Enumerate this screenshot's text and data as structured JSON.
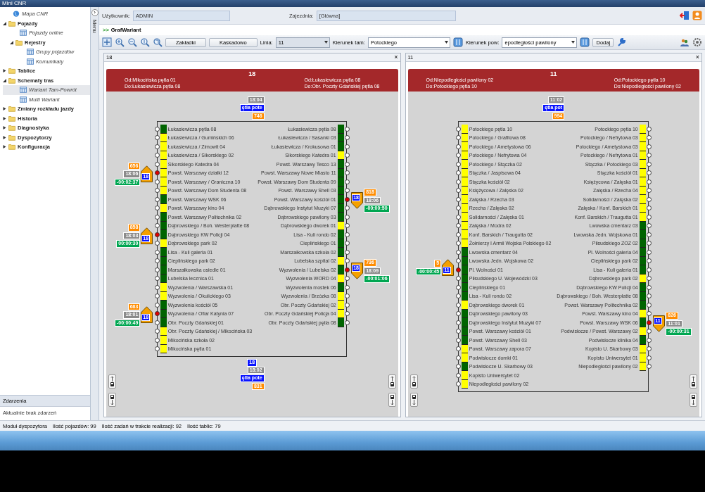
{
  "window": {
    "title": "Mini CNR"
  },
  "sidebar": {
    "items": [
      {
        "kind": "map",
        "label": "Mapa CNR",
        "selected": false
      },
      {
        "kind": "folder",
        "label": "Pojazdy",
        "expanded": true,
        "selected": false,
        "children": [
          {
            "kind": "view",
            "label": "Pojazdy online",
            "selected": false
          },
          {
            "kind": "folder",
            "label": "Rejestry",
            "expanded": true,
            "selected": false,
            "children": [
              {
                "kind": "view",
                "label": "Grupy pojazdów",
                "selected": false
              },
              {
                "kind": "view",
                "label": "Komunikaty",
                "selected": false
              }
            ]
          }
        ]
      },
      {
        "kind": "folder",
        "label": "Tablice",
        "expanded": false,
        "selected": false
      },
      {
        "kind": "folder",
        "label": "Schematy tras",
        "expanded": true,
        "selected": false,
        "children": [
          {
            "kind": "view",
            "label": "Wariant Tam-Powrót",
            "selected": true
          },
          {
            "kind": "view",
            "label": "Multi Wariant",
            "selected": false
          }
        ]
      },
      {
        "kind": "folder",
        "label": "Zmiany rozkładu jazdy",
        "expanded": false,
        "selected": false
      },
      {
        "kind": "folder",
        "label": "Historia",
        "expanded": false,
        "selected": false
      },
      {
        "kind": "folder",
        "label": "Diagnostyka",
        "expanded": false,
        "selected": false
      },
      {
        "kind": "folder",
        "label": "Dyspozytorzy",
        "expanded": false,
        "selected": false
      },
      {
        "kind": "folder",
        "label": "Konfiguracja",
        "expanded": false,
        "selected": false
      }
    ]
  },
  "events": {
    "title": "Zdarzenia",
    "message": "Aktualnie brak zdarzeń"
  },
  "menu_strip": {
    "label": "Menu",
    "toggle": "›"
  },
  "user_bar": {
    "user_label": "Użytkownik:",
    "user": "ADMIN",
    "depot_label": "Zajezdnia:",
    "depot": "[Główna]"
  },
  "breadcrumb": {
    "prefix": ">>",
    "title": "GrafWariant"
  },
  "toolbar": {
    "buttons": [
      "Zakładki",
      "Kaskadowo"
    ],
    "line_label": "Linia:",
    "line": "11",
    "dir_to_label": "Kierunek tam:",
    "dir_to": "Potockiego",
    "dir_back_label": "Kierunek pow:",
    "dir_back": "epodległości pawilony",
    "add": "Dodaj"
  },
  "panels": [
    {
      "tab": "18",
      "close": "×",
      "diagram": {
        "line": "18",
        "left_from": "Od:Mikocińska pętla 01",
        "left_to": "Do:Łukasiewicza pętla 08",
        "right_from": "Od:Łukasiewicza pętla 08",
        "right_to": "Do:Obr. Poczty Gdańskiej pętla 08",
        "top_vehicle": {
          "labels": [
            {
              "kind": "time",
              "text": "18:04"
            },
            {
              "kind": "route",
              "text": "ętla pote"
            },
            {
              "kind": "fleet",
              "text": "746"
            }
          ]
        },
        "bottom_vehicle": {
          "line": "18",
          "labels": [
            {
              "kind": "time",
              "text": "18:02"
            },
            {
              "kind": "route",
              "text": "ętla pote"
            },
            {
              "kind": "fleet",
              "text": "831"
            }
          ]
        },
        "left_stops": [
          {
            "name": "Łukasiewicza pętla 08",
            "color": "#006400"
          },
          {
            "name": "Łukasiewicza / Gumińskich 06",
            "color": "#ffff00"
          },
          {
            "name": "Łukasiewicza / Zimowit 04",
            "color": "#ffff00"
          },
          {
            "name": "Łukasiewicza / Sikorskiego 02",
            "color": "#ffff00"
          },
          {
            "name": "Sikorskiego Katedra 04",
            "color": "#ffff00"
          },
          {
            "name": "Powst. Warszawy działki 12",
            "color": "#ffff00",
            "vehicle": {
              "line": "18",
              "kind": "up",
              "labels": [
                {
                  "kind": "fleet",
                  "text": "656"
                },
                {
                  "kind": "time",
                  "text": "18:06"
                },
                {
                  "kind": "delay",
                  "text": "-00:02:37"
                }
              ]
            }
          },
          {
            "name": "Powst. Warszawy / Graniczna 10",
            "color": "#ffff00"
          },
          {
            "name": "Powst. Warszawy Dom Studenta 08",
            "color": "#ffff00"
          },
          {
            "name": "Powst. Warszawy WSK 06",
            "color": "#006400"
          },
          {
            "name": "Powst. Warszawy kino 04",
            "color": "#ffff00"
          },
          {
            "name": "Powst. Warszawy Politechnika 02",
            "color": "#006400"
          },
          {
            "name": "Dąbrowskiego / Boh. Westerplatte 08",
            "color": "#006400"
          },
          {
            "name": "Dąbrowskiego KW Policji 04",
            "color": "#006400",
            "vehicle": {
              "line": "18",
              "kind": "up",
              "labels": [
                {
                  "kind": "fleet",
                  "text": "858"
                },
                {
                  "kind": "time",
                  "text": "18:03"
                },
                {
                  "kind": "delay",
                  "text": "00:00:30"
                }
              ]
            }
          },
          {
            "name": "Dąbrowskiego park 02",
            "color": "#ffff00"
          },
          {
            "name": "Lisa - Kuli galeria 01",
            "color": "#006400"
          },
          {
            "name": "Cieplińskiego park 02",
            "color": "#006400"
          },
          {
            "name": "Marszałkowska osiedle 01",
            "color": "#006400"
          },
          {
            "name": "Lubelska lecznica 01",
            "color": "#006400"
          },
          {
            "name": "Wyzwolenia / Warszawska 01",
            "color": "#ffff00"
          },
          {
            "name": "Wyzwolenia / Okulickiego 03",
            "color": "#ffff00"
          },
          {
            "name": "Wyzwolenia kościół 05",
            "color": "#006400"
          },
          {
            "name": "Wyzwolenia / Ofiar Katynia 07",
            "color": "#006400",
            "vehicle": {
              "line": "18",
              "kind": "up",
              "labels": [
                {
                  "kind": "fleet",
                  "text": "683"
                },
                {
                  "kind": "time",
                  "text": "18:01"
                },
                {
                  "kind": "delay",
                  "text": "-00:00:49"
                }
              ]
            }
          },
          {
            "name": "Obr. Poczty Gdańskiej 01",
            "color": "#006400"
          },
          {
            "name": "Obr. Poczty Gdańskiej / Mikocińska 03",
            "color": "#ffff00"
          },
          {
            "name": "Mikocińska szkoła 02",
            "color": "#ffff00"
          },
          {
            "name": "Mikocińska pętla 01",
            "color": "#ffff00"
          }
        ],
        "right_stops": [
          {
            "name": "Łukasiewicza pętla 08",
            "color": "#006400"
          },
          {
            "name": "Łukasiewicza / Sasanki 03",
            "color": "#006400"
          },
          {
            "name": "Łukasiewicza / Krokusowa 01",
            "color": "#006400"
          },
          {
            "name": "Sikorskiego Katedra 01",
            "color": "#ffff00"
          },
          {
            "name": "Powst. Warszawy Tesco 13",
            "color": "#006400"
          },
          {
            "name": "Powst. Warszawy Nowe Miasto 11",
            "color": "#006400"
          },
          {
            "name": "Powst. Warszawy Dom Studenta 09",
            "color": "#006400"
          },
          {
            "name": "Powst. Warszawy Shell 03",
            "color": "#006400"
          },
          {
            "name": "Powst. Warszawy kościół 01",
            "color": "#006400",
            "vehicle": {
              "line": "18",
              "kind": "down",
              "labels": [
                {
                  "kind": "fleet",
                  "text": "818"
                },
                {
                  "kind": "time",
                  "text": "18:06"
                },
                {
                  "kind": "delay",
                  "text": "-00:00:50"
                }
              ]
            }
          },
          {
            "name": "Dąbrowskiego Instytut Muzyki 07",
            "color": "#006400"
          },
          {
            "name": "Dąbrowskiego pawilony 03",
            "color": "#006400"
          },
          {
            "name": "Dąbrowskiego dworek 01",
            "color": "#ffff00"
          },
          {
            "name": "Lisa - Kuli rondo 02",
            "color": "#006400"
          },
          {
            "name": "Cieplińskiego 01",
            "color": "#006400"
          },
          {
            "name": "Marszałkowska szkoła 02",
            "color": "#006400"
          },
          {
            "name": "Lubelska szpital 02",
            "color": "#ffff00"
          },
          {
            "name": "Wyzwolenia / Lubelska 02",
            "color": "#006400",
            "vehicle": {
              "line": "18",
              "kind": "down",
              "labels": [
                {
                  "kind": "fleet",
                  "text": "736"
                },
                {
                  "kind": "time",
                  "text": "18:09"
                },
                {
                  "kind": "delay",
                  "text": "-00:01:06"
                }
              ]
            }
          },
          {
            "name": "Wyzwolenia WORD 04",
            "color": "#ffff00"
          },
          {
            "name": "Wyzwolenia mostek 06",
            "color": "#006400"
          },
          {
            "name": "Wyzwolenia / Brzózka 08",
            "color": "#ffff00"
          },
          {
            "name": "Obr. Poczty Gdańskiej 02",
            "color": "#ffff00"
          },
          {
            "name": "Obr. Poczty Gdańskiej Policja 04",
            "color": "#ffff00"
          },
          {
            "name": "Obr. Poczty Gdańskiej pętla 08",
            "color": "#006400"
          }
        ]
      }
    },
    {
      "tab": "11",
      "close": "×",
      "diagram": {
        "line": "11",
        "left_from": "Od:Niepodległości pawilony 02",
        "left_to": "Do:Potockiego pętla 10",
        "right_from": "Od:Potockiego pętla 10",
        "right_to": "Do:Niepodległości pawilony 02",
        "top_vehicle": {
          "labels": [
            {
              "kind": "time",
              "text": "11:02"
            },
            {
              "kind": "route",
              "text": "ętla pot"
            },
            {
              "kind": "fleet",
              "text": "994"
            }
          ]
        },
        "left_stops": [
          {
            "name": "Potockiego pętla 10",
            "color": "#ffff00"
          },
          {
            "name": "Potockiego / Grafitowa 08",
            "color": "#ffff00"
          },
          {
            "name": "Potockiego / Ametystowa 06",
            "color": "#ffff00"
          },
          {
            "name": "Potockiego / Nefrytowa 04",
            "color": "#ffff00"
          },
          {
            "name": "Potockiego / Stączka 02",
            "color": "#ffff00"
          },
          {
            "name": "Stączka / Jaspisowa 04",
            "color": "#ffff00"
          },
          {
            "name": "Stączka kościół 02",
            "color": "#ffff00"
          },
          {
            "name": "Księżycowa / Zalęska 02",
            "color": "#ffff00"
          },
          {
            "name": "Zalęska / Rzecha 03",
            "color": "#ffff00"
          },
          {
            "name": "Rzecha / Zalęska 02",
            "color": "#ffff00"
          },
          {
            "name": "Solidarności / Zalęska 01",
            "color": "#ffff00"
          },
          {
            "name": "Zalęska / Modra 02",
            "color": "#ffff00"
          },
          {
            "name": "Konf. Barskich / Traugutta 02",
            "color": "#ffff00"
          },
          {
            "name": "Żołnierzy I Armii Wojska Polskiego 02",
            "color": "#ffff00"
          },
          {
            "name": "Lwowska cmentarz 04",
            "color": "#006400"
          },
          {
            "name": "Lwowska Jedn. Wojskowa 02",
            "color": "#006400"
          },
          {
            "name": "Pl. Wolności 01",
            "color": "#006400",
            "vehicle": {
              "line": "11",
              "kind": "up",
              "labels": [
                {
                  "kind": "fleet",
                  "text": "5"
                },
                {
                  "kind": "delay",
                  "text": "-00:00:45"
                }
              ]
            }
          },
          {
            "name": "Piłsudskiego U. Wojewódzki 03",
            "color": "#006400"
          },
          {
            "name": "Cieplińskiego 01",
            "color": "#006400"
          },
          {
            "name": "Lisa - Kuli rondo 02",
            "color": "#006400"
          },
          {
            "name": "Dąbrowskiego dworek 01",
            "color": "#ffff00"
          },
          {
            "name": "Dąbrowskiego pawilony 03",
            "color": "#006400"
          },
          {
            "name": "Dąbrowskiego Instytut Muzyki 07",
            "color": "#006400"
          },
          {
            "name": "Powst. Warszawy kościół 01",
            "color": "#006400"
          },
          {
            "name": "Powst. Warszawy Shell 03",
            "color": "#006400"
          },
          {
            "name": "Powst. Warszawy zapora 07",
            "color": "#ffff00"
          },
          {
            "name": "Podwisłocze domki 01",
            "color": "#ffff00"
          },
          {
            "name": "Podwisłocze U. Skarbowy 03",
            "color": "#006400"
          },
          {
            "name": "Kopisto Uniwersytet 02",
            "color": "#ffff00"
          },
          {
            "name": "Niepodległości pawilony 02",
            "color": "#ffff00"
          }
        ],
        "right_stops": [
          {
            "name": "Potockiego pętla 10",
            "color": "#ffff00"
          },
          {
            "name": "Potockiego / Nefrytowa 03",
            "color": "#ffff00"
          },
          {
            "name": "Potockiego / Ametystowa 03",
            "color": "#ffff00"
          },
          {
            "name": "Potockiego / Nefrytowa 01",
            "color": "#ffff00"
          },
          {
            "name": "Stączka / Potockiego 03",
            "color": "#ffff00"
          },
          {
            "name": "Stączka kościół 01",
            "color": "#ffff00"
          },
          {
            "name": "Księżycowa / Zalęska 01",
            "color": "#ffff00"
          },
          {
            "name": "Zalęska / Rzecha 04",
            "color": "#ffff00"
          },
          {
            "name": "Solidarności / Zalęska 02",
            "color": "#ffff00"
          },
          {
            "name": "Zalęska / Konf. Barskich 01",
            "color": "#ffff00"
          },
          {
            "name": "Konf. Barskich / Traugutta 01",
            "color": "#ffff00"
          },
          {
            "name": "Lwowska cmentarz 03",
            "color": "#006400"
          },
          {
            "name": "Lwowska Jedn. Wojskowa 01",
            "color": "#006400"
          },
          {
            "name": "Piłsudskiego ZOZ 02",
            "color": "#006400"
          },
          {
            "name": "Pl. Wolności galeria 04",
            "color": "#006400"
          },
          {
            "name": "Cieplińskiego park 02",
            "color": "#006400"
          },
          {
            "name": "Lisa - Kuli galeria 01",
            "color": "#006400"
          },
          {
            "name": "Dąbrowskiego park 02",
            "color": "#ffff00"
          },
          {
            "name": "Dąbrowskiego KW Policji 04",
            "color": "#006400"
          },
          {
            "name": "Dąbrowskiego / Boh. Westerplatte 08",
            "color": "#006400"
          },
          {
            "name": "Powst. Warszawy Politechnika 02",
            "color": "#006400"
          },
          {
            "name": "Powst. Warszawy kino 04",
            "color": "#ffff00"
          },
          {
            "name": "Powst. Warszawy WSK 06",
            "color": "#006400",
            "vehicle": {
              "line": "11",
              "kind": "down",
              "labels": [
                {
                  "kind": "fleet",
                  "text": "826"
                },
                {
                  "kind": "time",
                  "text": "11:01"
                },
                {
                  "kind": "delay",
                  "text": "-00:00:31"
                }
              ]
            }
          },
          {
            "name": "Podwisłocze / Powst. Warszawy 02",
            "color": "#ffff00"
          },
          {
            "name": "Podwisłocze klinika 04",
            "color": "#006400"
          },
          {
            "name": "Kopisto U. Skarbowy 03",
            "color": "#ffff00"
          },
          {
            "name": "Kopisto Uniwersytet 01",
            "color": "#ffff00"
          },
          {
            "name": "Niepodległości pawilony 02",
            "color": "#ffff00"
          }
        ]
      }
    }
  ],
  "status_bar": [
    "Moduł dyspozytora",
    "Ilość pojazdów: 99",
    "Ilość zadań w trakcie realizacji: 92",
    "Ilość tablic: 79"
  ]
}
